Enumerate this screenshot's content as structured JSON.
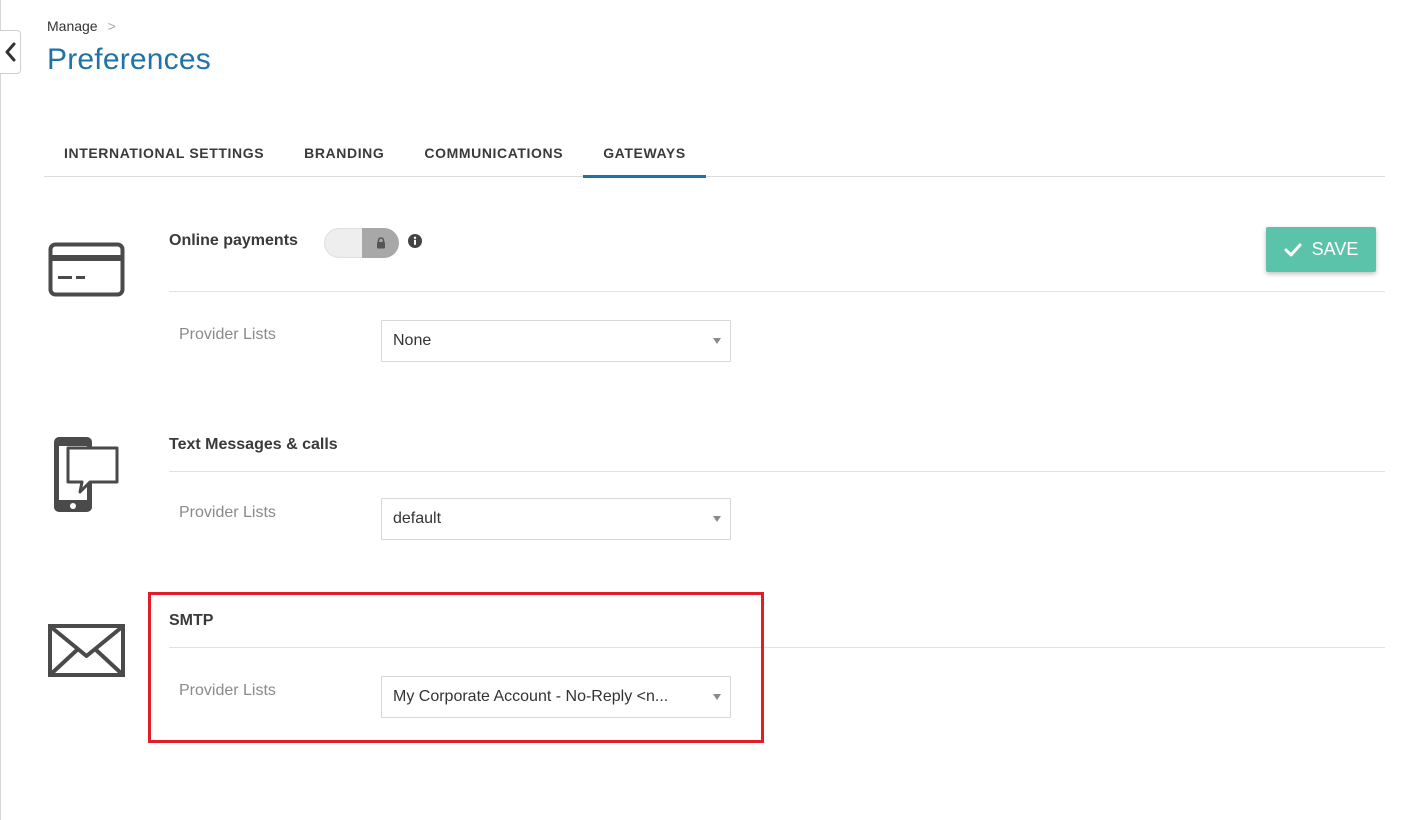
{
  "breadcrumb": {
    "parent": "Manage",
    "separator": ">"
  },
  "page_title": "Preferences",
  "tabs": [
    {
      "label": "INTERNATIONAL SETTINGS",
      "active": false
    },
    {
      "label": "BRANDING",
      "active": false
    },
    {
      "label": "COMMUNICATIONS",
      "active": false
    },
    {
      "label": "GATEWAYS",
      "active": true
    }
  ],
  "save_button": {
    "label": "SAVE",
    "color": "#5cc3ab"
  },
  "sections": {
    "online_payments": {
      "icon": "credit-card-icon",
      "title": "Online payments",
      "toggle_state": "locked",
      "provider_label": "Provider Lists",
      "provider_value": "None"
    },
    "text_messages": {
      "icon": "phone-chat-icon",
      "title": "Text Messages & calls",
      "provider_label": "Provider Lists",
      "provider_value": "default"
    },
    "smtp": {
      "icon": "envelope-icon",
      "title": "SMTP",
      "provider_label": "Provider Lists",
      "provider_value": "My Corporate Account - No-Reply <n..."
    }
  },
  "colors": {
    "accent": "#1f73a8",
    "highlight": "#e21d2a"
  }
}
